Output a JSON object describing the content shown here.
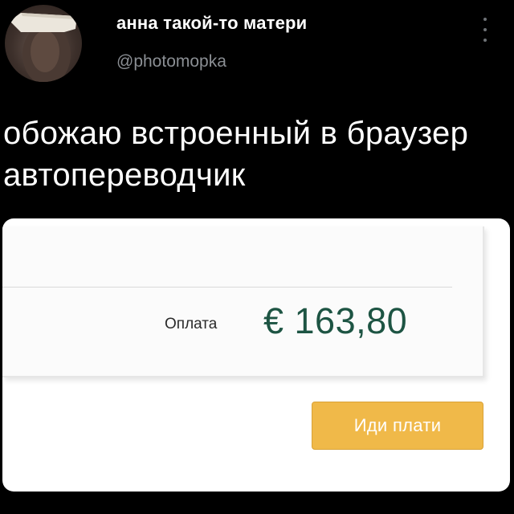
{
  "tweet": {
    "display_name": "анна такой-то матери",
    "username": "@photomopka",
    "avatar_icon": "user-avatar-icon",
    "more_icon": "more-options-icon",
    "text": "обожаю встроенный в браузер автопереводчик"
  },
  "screenshot": {
    "payment_label": "Оплата",
    "payment_amount": "€ 163,80",
    "amount_color": "#1d5443",
    "button_label": "Иди плати",
    "button_color": "#f0b949"
  }
}
